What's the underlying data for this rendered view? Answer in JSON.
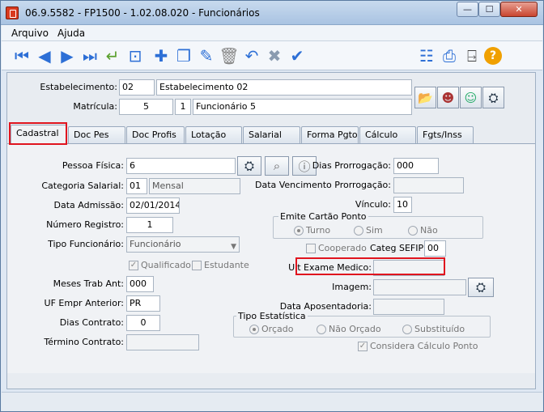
{
  "window": {
    "title": "06.9.5582 - FP1500 - 1.02.08.020 - Funcionários",
    "min": "—",
    "max": "☐",
    "close": "✕"
  },
  "menu": [
    "Arquivo",
    "Ajuda"
  ],
  "header": {
    "estabelecimento_label": "Estabelecimento:",
    "estabelecimento_code": "02",
    "estabelecimento_name": "Estabelecimento 02",
    "matricula_label": "Matrícula:",
    "matricula_value": "5",
    "matricula_seq": "1",
    "matricula_name": "Funcionário 5"
  },
  "tabs": [
    "Cadastral",
    "Doc Pes",
    "Doc Profis",
    "Lotação",
    "Salarial",
    "Forma Pgto",
    "Cálculo",
    "Fgts/Inss"
  ],
  "cadastral": {
    "pessoa_fisica_label": "Pessoa Física:",
    "pessoa_fisica_value": "6",
    "categoria_label": "Categoria Salarial:",
    "categoria_code": "01",
    "categoria_name": "Mensal",
    "admissao_label": "Data Admissão:",
    "admissao_value": "02/01/2014",
    "registro_label": "Número Registro:",
    "registro_value": "1",
    "tipo_func_label": "Tipo Funcionário:",
    "tipo_func_value": "Funcionário",
    "qualificado_label": "Qualificado",
    "estudante_label": "Estudante",
    "meses_label": "Meses Trab Ant:",
    "meses_value": "000",
    "uf_label": "UF Empr Anterior:",
    "uf_value": "PR",
    "dias_contrato_label": "Dias Contrato:",
    "dias_contrato_value": "0",
    "termino_label": "Término Contrato:",
    "termino_value": "",
    "dias_prorrog_label": "Dias Prorrogação:",
    "dias_prorrog_value": "000",
    "venc_prorrog_label": "Data Vencimento Prorrogação:",
    "venc_prorrog_value": "",
    "vinculo_label": "Vínculo:",
    "vinculo_value": "10",
    "emite_title": "Emite Cartão Ponto",
    "emite_options": [
      "Turno",
      "Sim",
      "Não"
    ],
    "cooperado_label": "Cooperado",
    "sefip_label": "Categ SEFIP:",
    "sefip_value": "00",
    "ult_exame_label": "Ult Exame Medico:",
    "ult_exame_value": "",
    "imagem_label": "Imagem:",
    "imagem_value": "",
    "aposentadoria_label": "Data Aposentadoria:",
    "aposentadoria_value": "",
    "tipo_estat_title": "Tipo Estatística",
    "tipo_estat_options": [
      "Orçado",
      "Não Orçado",
      "Substituído"
    ],
    "considera_label": "Considera Cálculo Ponto"
  },
  "colors": {
    "highlight": "#e0141e",
    "accent": "#2d6fd6"
  }
}
